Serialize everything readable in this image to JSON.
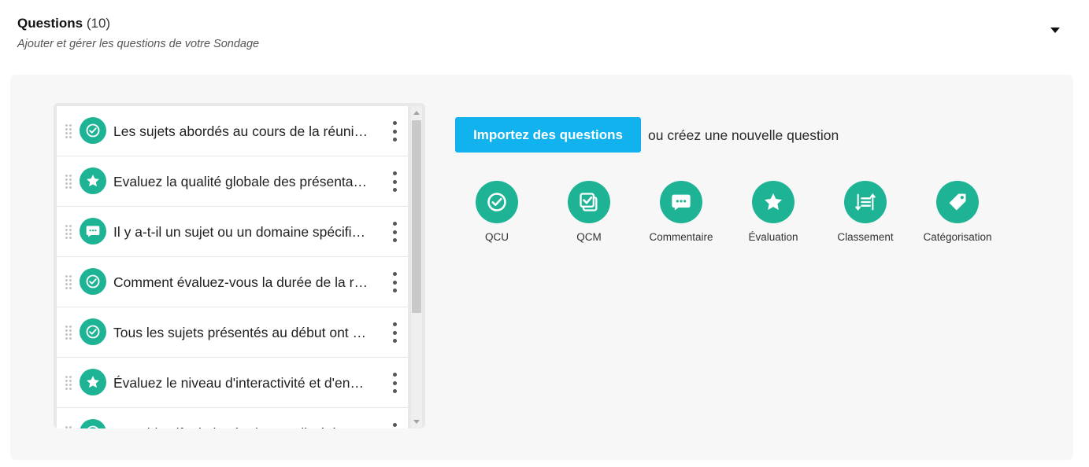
{
  "header": {
    "title": "Questions",
    "count": "(10)",
    "subtitle": "Ajouter et gérer les questions de votre Sondage"
  },
  "questions": [
    {
      "icon": "check-circle-icon",
      "text": "Les sujets abordés au cours de la réunion"
    },
    {
      "icon": "star-icon",
      "text": "Evaluez la qualité globale des présentations"
    },
    {
      "icon": "comment-icon",
      "text": "Il y a-t-il un sujet ou un domaine spécifique"
    },
    {
      "icon": "check-circle-icon",
      "text": "Comment évaluez-vous la durée de la réunion"
    },
    {
      "icon": "check-circle-icon",
      "text": "Tous les sujets présentés au début ont été"
    },
    {
      "icon": "star-icon",
      "text": "Évaluez le niveau d'interactivité et d'engagement"
    },
    {
      "icon": "check-circle-icon",
      "text": "Les objectifs de la réunion ont-ils été"
    }
  ],
  "actions": {
    "import_label": "Importez des questions",
    "or_create": "ou créez une nouvelle question"
  },
  "question_types": [
    {
      "icon": "check-circle-icon",
      "label": "QCU"
    },
    {
      "icon": "multi-check-icon",
      "label": "QCM"
    },
    {
      "icon": "comment-icon",
      "label": "Commentaire"
    },
    {
      "icon": "star-icon",
      "label": "Évaluation"
    },
    {
      "icon": "ranking-icon",
      "label": "Classement"
    },
    {
      "icon": "tag-icon",
      "label": "Catégorisation"
    }
  ],
  "colors": {
    "accent": "#1db394",
    "import_button": "#12b2ee",
    "panel_bg": "#f7f7f7"
  }
}
